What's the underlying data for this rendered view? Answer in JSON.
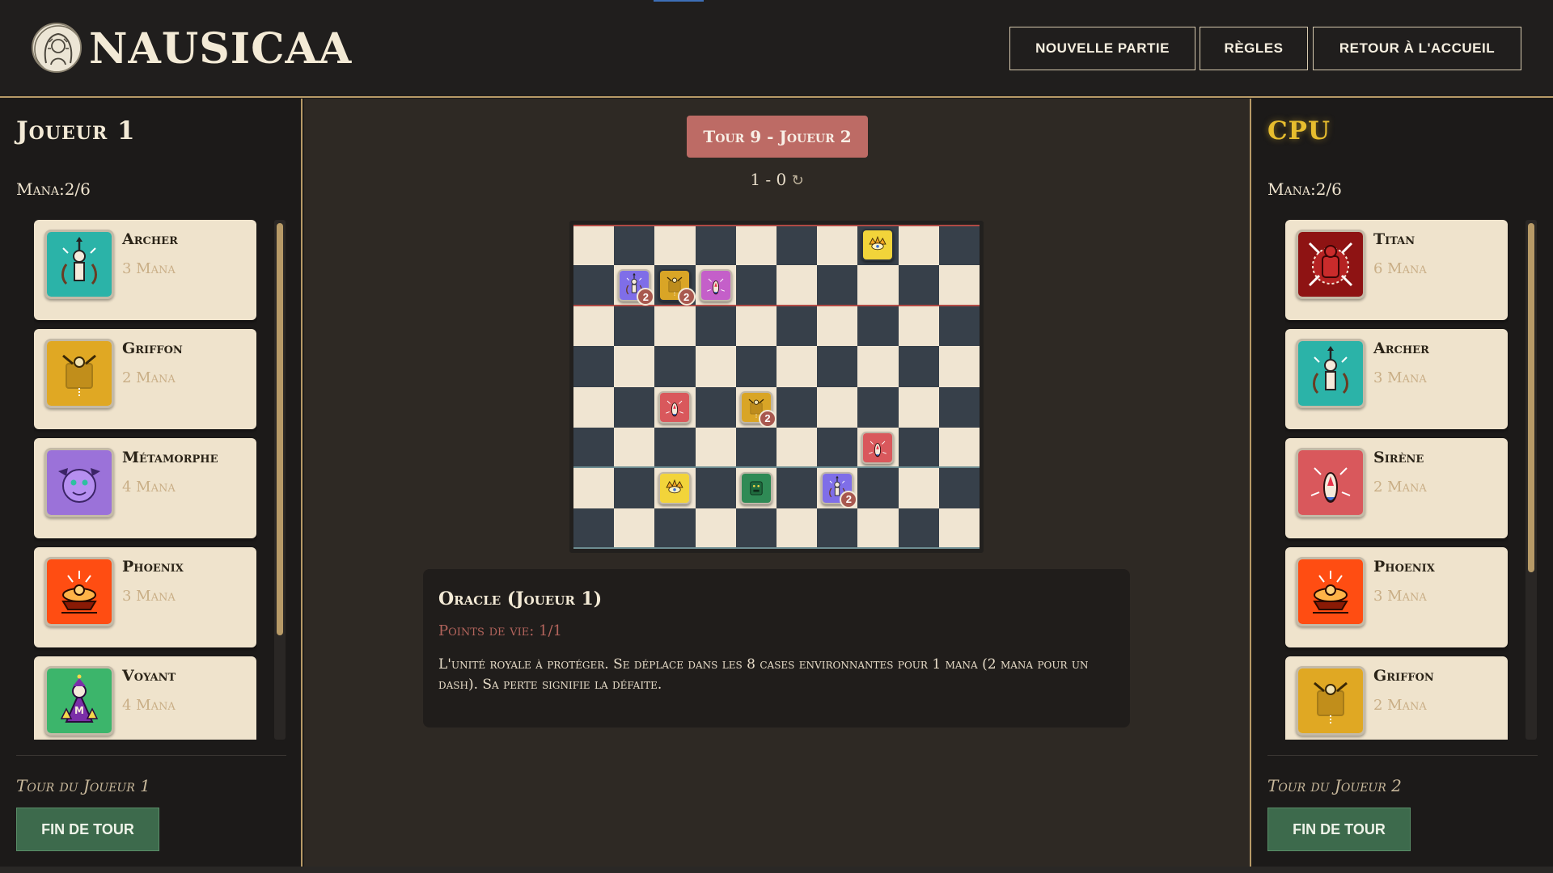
{
  "header": {
    "brand": "NAUSICAA",
    "nav": {
      "new_game": "NOUVELLE PARTIE",
      "rules": "RÈGLES",
      "home": "RETOUR À L'ACCUEIL"
    }
  },
  "player1": {
    "name": "Joueur 1",
    "mana": "Mana:2/6",
    "cards": [
      {
        "name": "Archer",
        "cost": "3 Mana",
        "icon": "archer-icon",
        "color": "#2bb3a8"
      },
      {
        "name": "Griffon",
        "cost": "2 Mana",
        "icon": "griffon-icon",
        "color": "#e0a823"
      },
      {
        "name": "Métamorphe",
        "cost": "4 Mana",
        "icon": "metamorph-icon",
        "color": "#9b72d9"
      },
      {
        "name": "Phoenix",
        "cost": "3 Mana",
        "icon": "phoenix-icon",
        "color": "#ff4d12"
      },
      {
        "name": "Voyant",
        "cost": "4 Mana",
        "icon": "seer-icon",
        "color": "#3cb56b"
      }
    ],
    "turn_label": "Tour du Joueur 1",
    "end_turn": "FIN DE TOUR"
  },
  "player2": {
    "name": "CPU",
    "mana": "Mana:2/6",
    "cards": [
      {
        "name": "Titan",
        "cost": "6 Mana",
        "icon": "titan-icon",
        "color": "#8e1313"
      },
      {
        "name": "Archer",
        "cost": "3 Mana",
        "icon": "archer-icon",
        "color": "#2bb3a8"
      },
      {
        "name": "Sirène",
        "cost": "2 Mana",
        "icon": "siren-icon",
        "color": "#d9585c"
      },
      {
        "name": "Phoenix",
        "cost": "3 Mana",
        "icon": "phoenix-icon",
        "color": "#ff4d12"
      },
      {
        "name": "Griffon",
        "cost": "2 Mana",
        "icon": "griffon-icon",
        "color": "#e0a823"
      }
    ],
    "turn_label": "Tour du Joueur 2",
    "end_turn": "FIN DE TOUR"
  },
  "game": {
    "turn_banner": "Tour 9 - Joueur 2",
    "score": "1 - 0",
    "board": {
      "cols": 10,
      "rows": 8,
      "pieces": [
        {
          "row": 0,
          "col": 7,
          "type": "oracle",
          "color": "#f2d43a",
          "hp": null
        },
        {
          "row": 1,
          "col": 1,
          "type": "archer",
          "color": "#7f6ee8",
          "hp": "2"
        },
        {
          "row": 1,
          "col": 2,
          "type": "griffon",
          "color": "#d9a526",
          "hp": "2"
        },
        {
          "row": 1,
          "col": 3,
          "type": "siren",
          "color": "#c45fc9",
          "hp": null
        },
        {
          "row": 4,
          "col": 2,
          "type": "siren",
          "color": "#d9585c",
          "hp": null
        },
        {
          "row": 4,
          "col": 4,
          "type": "griffon",
          "color": "#d9a526",
          "hp": "2"
        },
        {
          "row": 5,
          "col": 7,
          "type": "siren",
          "color": "#d9585c",
          "hp": null
        },
        {
          "row": 6,
          "col": 2,
          "type": "oracle",
          "color": "#f2d43a",
          "hp": null
        },
        {
          "row": 6,
          "col": 4,
          "type": "golem",
          "color": "#2f8a55",
          "hp": null
        },
        {
          "row": 6,
          "col": 6,
          "type": "archer",
          "color": "#7f6ee8",
          "hp": "2"
        }
      ]
    },
    "info": {
      "title": "Oracle (Joueur 1)",
      "hp": "Points de vie: 1/1",
      "description": "L'unité royale à protéger. Se déplace dans les 8 cases environnantes pour 1 mana (2 mana pour un dash). Sa perte signifie la défaite."
    }
  }
}
